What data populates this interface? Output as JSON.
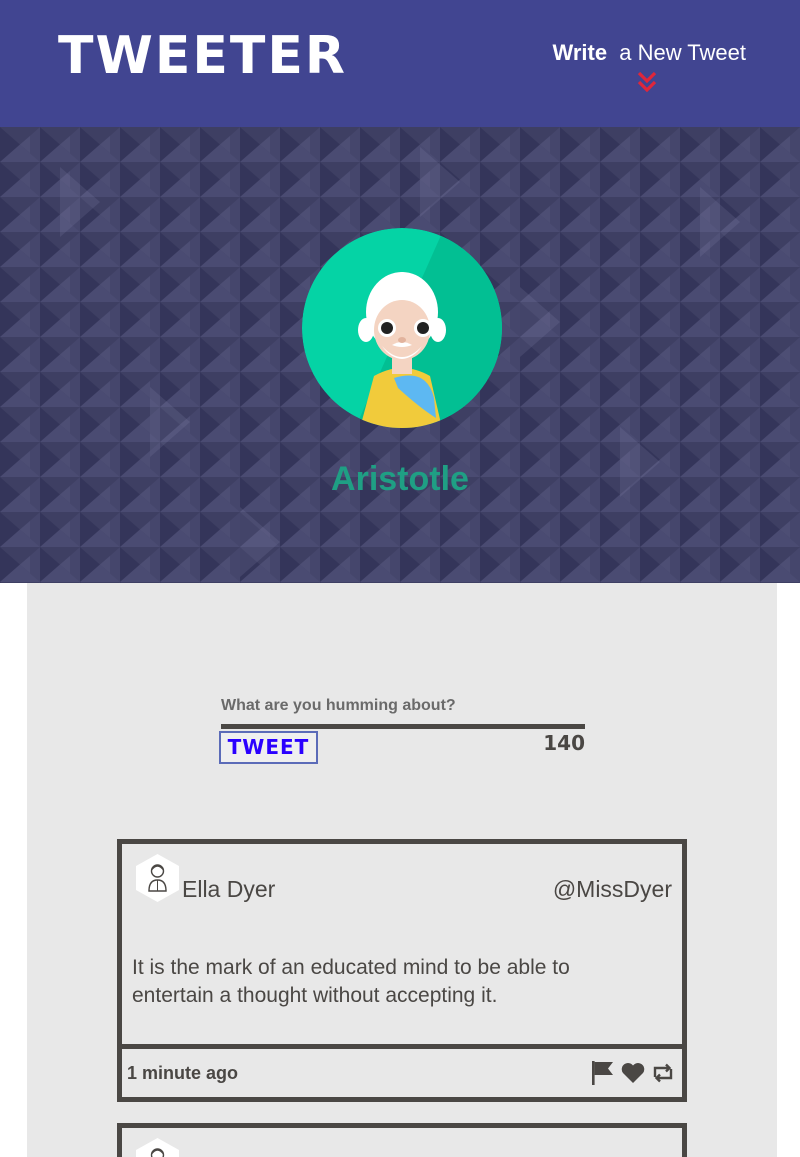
{
  "nav": {
    "brand": "TWEETER",
    "compose_bold": "Write",
    "compose_text": "a New Tweet"
  },
  "profile": {
    "name": "Aristotle"
  },
  "compose": {
    "label": "What are you humming about?",
    "button": "TWEET",
    "counter": "140"
  },
  "tweets": [
    {
      "name": "Ella Dyer",
      "handle": "@MissDyer",
      "content": "It is the mark of an educated mind to be able to entertain a thought without accepting it.",
      "timestamp": "1 minute ago"
    }
  ],
  "colors": {
    "nav_bg": "#414591",
    "hero_bg": "#3a3b5e",
    "accent_name": "#1f9f84",
    "tweet_button_text": "#2a00ff",
    "chevron": "#e0263a",
    "dark": "#4a4744"
  },
  "icons": [
    "chevron-down-icon",
    "flag-icon",
    "heart-icon",
    "retweet-icon"
  ]
}
